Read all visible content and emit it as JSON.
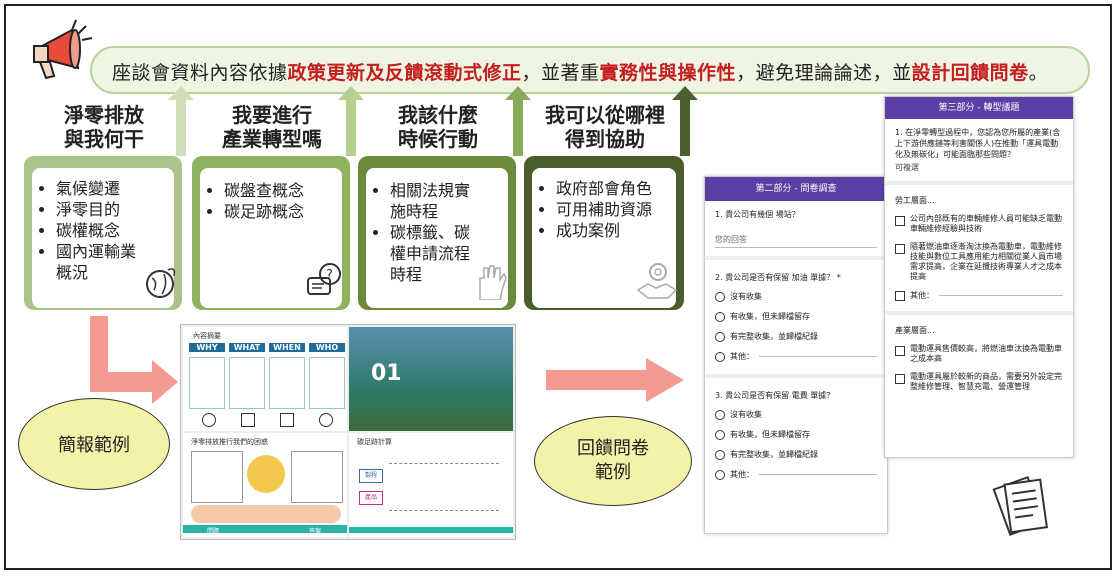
{
  "banner": {
    "part1": "座談會資料內容依據",
    "hl1": "政策更新及反饋滾動式修正",
    "part2": "，並著重",
    "hl2": "實務性與操作性",
    "part3": "，避免理論論述，並",
    "hl3": "設計回饋問卷",
    "part4": "。"
  },
  "cards": [
    {
      "title1": "淨零排放",
      "title2": "與我何干",
      "items": [
        "氣候變遷",
        "淨零目的",
        "碳權概念",
        "國內運輸業",
        "概況"
      ],
      "color": "#a9c48a",
      "icon": "earth-icon"
    },
    {
      "title1": "我要進行",
      "title2": "產業轉型嗎",
      "items": [
        "碳盤查概念",
        "碳足跡概念"
      ],
      "color": "#8eb35c",
      "icon": "question-chat-icon"
    },
    {
      "title1": "我該什麼",
      "title2": "時候行動",
      "items": [
        "相關法規實",
        "施時程",
        "碳標籤、碳",
        "權申請流程",
        "時程"
      ],
      "color": "#6b8a3a",
      "icon": "raised-fist-icon"
    },
    {
      "title1": "我可以從哪裡",
      "title2": "得到協助",
      "items": [
        "政府部會角色",
        "可用補助資源",
        "成功案例"
      ],
      "color": "#4a5e2c",
      "icon": "handshake-gear-icon"
    }
  ],
  "bubbles": {
    "slides_label": "簡報範例",
    "survey_label1": "回饋問卷",
    "survey_label2": "範例"
  },
  "slides": {
    "s1_title": "內容摘要",
    "s1_cols": [
      "WHY",
      "WHAT",
      "WHEN",
      "WHO"
    ],
    "s2_big": "01",
    "s3_title": "淨零排放推行我們的困惑",
    "s3_left": "問題",
    "s3_right": "答案",
    "s4_title": "碳足跡計算",
    "s4_left1": "製程",
    "s4_left2": "產品"
  },
  "survey1": {
    "header": "第二部分 - 問卷調查",
    "q1": "1. 貴公司有幾個 場站？",
    "q1_placeholder": "您的回答",
    "q2": "2. 貴公司是否有保留 加油 單據？ *",
    "q3": "3. 貴公司是否有保留 電費 單據？",
    "options": [
      "沒有收集",
      "有收集，但未歸檔留存",
      "有完整收集，並歸檔紀錄",
      "其他："
    ]
  },
  "survey2": {
    "header": "第三部分 - 轉型議題",
    "q1": "1. 在淨零轉型過程中，您認為您所屬的產業(含上下游供應鏈等利害關係人)在推動「運具電動化及無碳化」可能面臨那些問題？",
    "q1_note": "可複選",
    "sec1": "勞工層面...",
    "sec1_items": [
      "公司內部既有的車輛維修人員可能缺乏電動車輛維修經驗與技術",
      "隨著燃油車逐漸淘汰換為電動車，電動維修技能與數位工具應用能力相關從業人員市場需求提高，企業在延攬技術專業人才之成本提高",
      "其他："
    ],
    "sec2": "產業層面...",
    "sec2_items": [
      "電動運具售價較高，將燃油車汰換為電動車之成本高",
      "電動運具屬於較新的商品，需要另外設定完整維修管理、智慧充電、營運管理"
    ]
  }
}
